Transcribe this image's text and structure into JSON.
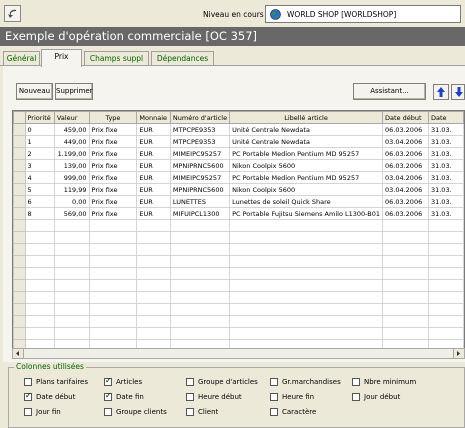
{
  "toolbar": {
    "back_icon": "back-arrow-icon",
    "niveau_label": "Niveau en cours",
    "niveau_value": "WORLD SHOP  [WORLDSHOP]",
    "globe_icon": "globe-icon"
  },
  "window": {
    "title": "Exemple d'opération commerciale   [OC 357]"
  },
  "tabs": [
    {
      "label": "Général"
    },
    {
      "label": "Prix"
    },
    {
      "label": "Champs suppl"
    },
    {
      "label": "Dépendances"
    }
  ],
  "buttons": {
    "nouveau": "Nouveau",
    "supprimer": "Supprimer",
    "assistant": "Assistant..."
  },
  "table": {
    "headers": [
      "Priorité",
      "Valeur",
      "Type",
      "Monnaie",
      "Numéro d'article",
      "Libellé article",
      "Date début",
      "Date"
    ],
    "rows": [
      [
        "0",
        "459,00",
        "Prix fixe",
        "EUR",
        "MTPCPE9353",
        "Unité Centrale Newdata",
        "06.03.2006",
        "31.03."
      ],
      [
        "1",
        "449,00",
        "Prix fixe",
        "EUR",
        "MTPCPE9353",
        "Unité Centrale Newdata",
        "03.04.2006",
        "31.03."
      ],
      [
        "2",
        "1.199,00",
        "Prix fixe",
        "EUR",
        "MIMEIPC95257",
        "PC Portable Medion Pentium MD 95257",
        "06.03.2006",
        "31.03."
      ],
      [
        "3",
        "139,00",
        "Prix fixe",
        "EUR",
        "MPNIPRNC5600",
        "Nikon Coolpix 5600",
        "06.03.2006",
        "31.03."
      ],
      [
        "4",
        "999,00",
        "Prix fixe",
        "EUR",
        "MIMEIPC95257",
        "PC Portable Medion Pentium MD 95257",
        "03.04.2006",
        "31.03."
      ],
      [
        "5",
        "119,99",
        "Prix fixe",
        "EUR",
        "MPNIPRNC5600",
        "Nikon Coolpix 5600",
        "03.04.2006",
        "31.03."
      ],
      [
        "6",
        "0,00",
        "Prix fixe",
        "EUR",
        "LUNETTES",
        "Lunettes de soleil Quick Share",
        "06.03.2006",
        "31.03."
      ],
      [
        "8",
        "569,00",
        "Prix fixe",
        "EUR",
        "MIFUIPCL1300",
        "PC Portable Fujitsu Siemens Amilo L1300-B01",
        "06.03.2006",
        "31.03."
      ]
    ],
    "empty_rows": 14
  },
  "colonnes": {
    "title": "Colonnes utilisées",
    "items": [
      {
        "label": "Plans tarifaires",
        "checked": false
      },
      {
        "label": "Articles",
        "checked": true
      },
      {
        "label": "Groupe d'articles",
        "checked": false
      },
      {
        "label": "Gr.marchandises",
        "checked": false
      },
      {
        "label": "Nbre minimum",
        "checked": false
      },
      {
        "label": "Date début",
        "checked": true
      },
      {
        "label": "Date fin",
        "checked": true
      },
      {
        "label": "Heure début",
        "checked": false
      },
      {
        "label": "Heure fin",
        "checked": false
      },
      {
        "label": "Jour début",
        "checked": false
      },
      {
        "label": "Jour fin",
        "checked": false
      },
      {
        "label": "Groupe clients",
        "checked": false
      },
      {
        "label": "Client",
        "checked": false
      },
      {
        "label": "Caractère",
        "checked": false
      }
    ]
  },
  "colors": {
    "title_bg": "#686868",
    "tab_text": "#006400",
    "arrow": "#1e3fc8"
  }
}
